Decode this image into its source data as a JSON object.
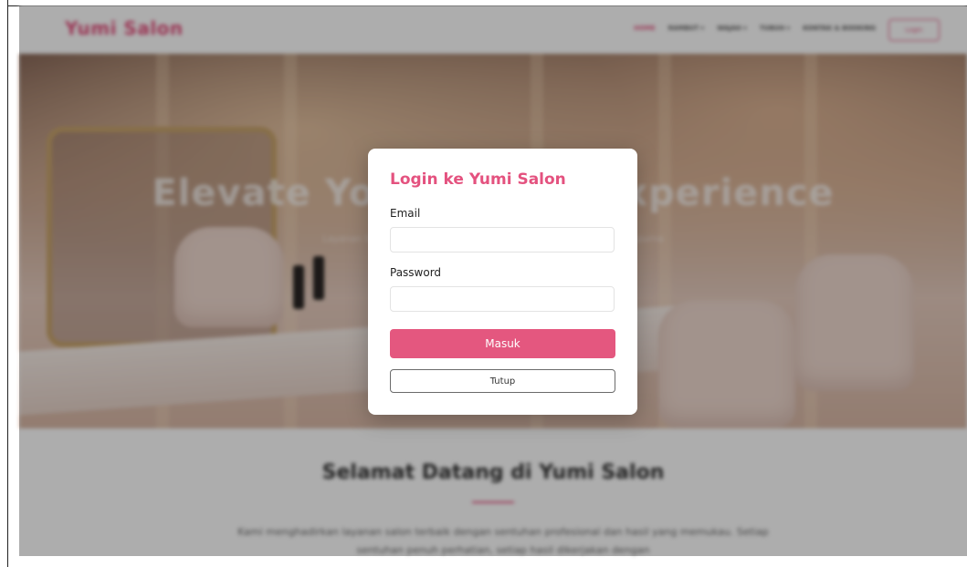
{
  "navbar": {
    "brand": "Yumi Salon",
    "links": [
      "HOME",
      "RAMBUT ▾",
      "WAJAH ▾",
      "TUBUH ▾",
      "KONTAK & BOOKING"
    ],
    "login_label": "Login"
  },
  "hero": {
    "title": "Elevate Your Beauty Experience",
    "subtitle": "Layanan Salon Profesional dengan Sentuhan Personal dan Hasil Sempurna"
  },
  "welcome": {
    "title": "Selamat Datang di Yumi Salon",
    "text": "Kami menghadirkan layanan salon terbaik dengan sentuhan profesional dan hasil yang memukau. Setiap sentuhan penuh perhatian, setiap hasil dikerjakan dengan"
  },
  "modal": {
    "title": "Login ke Yumi Salon",
    "email_label": "Email",
    "email_value": "",
    "password_label": "Password",
    "password_value": "",
    "submit_label": "Masuk",
    "close_label": "Tutup"
  },
  "colors": {
    "accent": "#e4527f",
    "button": "#e4577f",
    "overlay": "rgba(0,0,0,0.32)"
  }
}
